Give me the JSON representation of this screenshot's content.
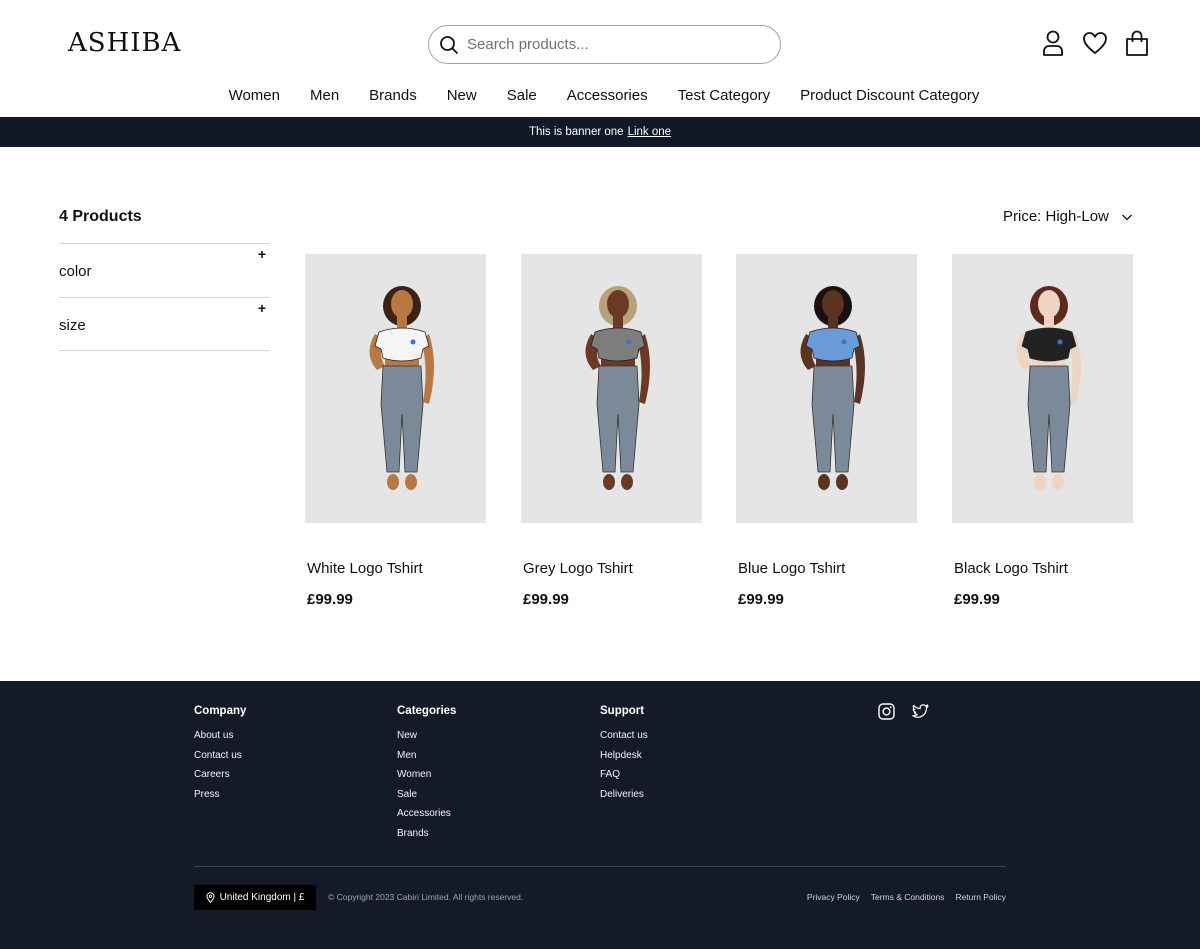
{
  "header": {
    "logo": "ASHIBA",
    "search_placeholder": "Search products...",
    "icons": [
      "search-icon",
      "user-icon",
      "heart-icon",
      "bag-icon"
    ]
  },
  "nav": {
    "items": [
      "Women",
      "Men",
      "Brands",
      "New",
      "Sale",
      "Accessories",
      "Test Category",
      "Product Discount Category"
    ]
  },
  "banner": {
    "text": "This is banner one",
    "link": "Link one"
  },
  "listing": {
    "count_label": "4 Products",
    "sort_label": "Price: High-Low",
    "filters": [
      {
        "label": "color",
        "toggle": "+"
      },
      {
        "label": "size",
        "toggle": "+"
      }
    ],
    "products": [
      {
        "name": "White Logo Tshirt",
        "price": "£99.99",
        "top_color": "#f5f5f5",
        "skin": "#b9783f",
        "hair": "#3a2214"
      },
      {
        "name": "Grey Logo Tshirt",
        "price": "£99.99",
        "top_color": "#7d7d7d",
        "skin": "#6b3a24",
        "hair": "#b8a27a"
      },
      {
        "name": "Blue Logo Tshirt",
        "price": "£99.99",
        "top_color": "#6a9ad8",
        "skin": "#5a3420",
        "hair": "#1a1010"
      },
      {
        "name": "Black Logo Tshirt",
        "price": "£99.99",
        "top_color": "#222222",
        "skin": "#eed4c3",
        "hair": "#5c2a18"
      }
    ]
  },
  "footer": {
    "columns": [
      {
        "title": "Company",
        "links": [
          "About us",
          "Contact us",
          "Careers",
          "Press"
        ]
      },
      {
        "title": "Categories",
        "links": [
          "New",
          "Men",
          "Women",
          "Sale",
          "Accessories",
          "Brands"
        ]
      },
      {
        "title": "Support",
        "links": [
          "Contact us",
          "Helpdesk",
          "FAQ",
          "Deliveries"
        ]
      }
    ],
    "social_icons": [
      "instagram-icon",
      "twitter-icon"
    ],
    "locale": "United Kingdom | £",
    "copyright": "© Copyright 2023 Cabiri Limited. All rights reserved.",
    "legal_links": [
      "Privacy Policy",
      "Terms & Conditions",
      "Return Policy"
    ]
  },
  "colors": {
    "banner_bg": "#111827",
    "footer_bg": "#151a28",
    "product_bg": "#e5e5e5",
    "jeans": "#7b8a99"
  }
}
